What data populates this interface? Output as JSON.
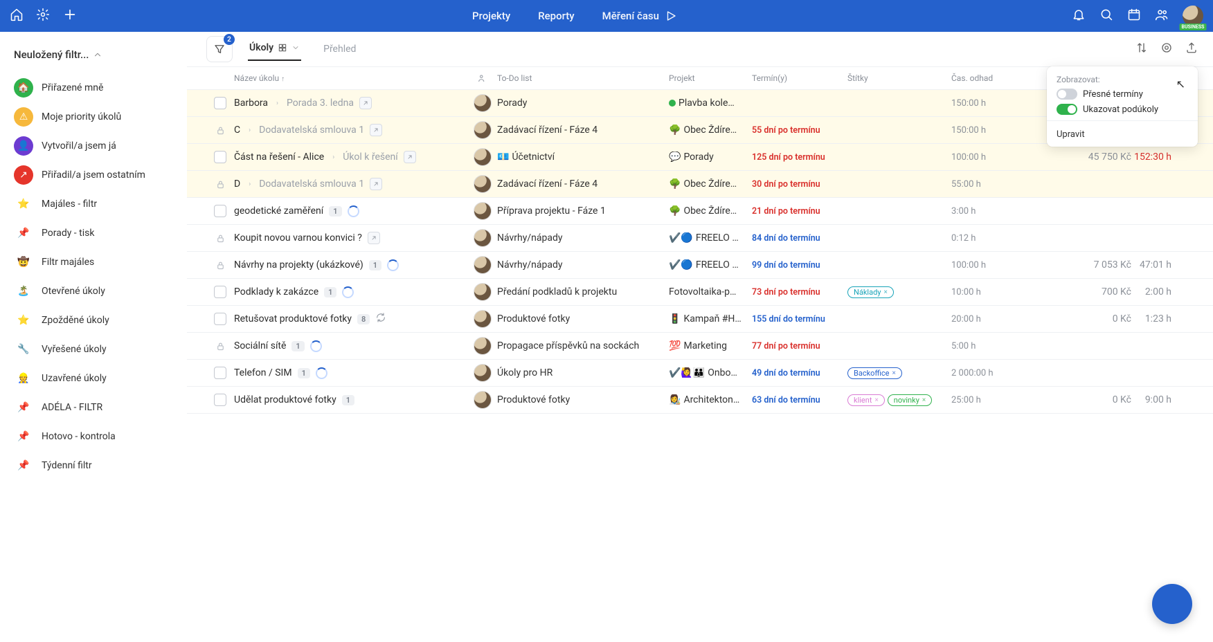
{
  "topbar": {
    "nav": {
      "projects": "Projekty",
      "reports": "Reporty",
      "timetracking": "Měření času"
    }
  },
  "sidebar": {
    "filter_title": "Neuložený filtr...",
    "items": [
      {
        "label": "Přiřazené mně",
        "icon": "🏠",
        "bg": "#2fb24c"
      },
      {
        "label": "Moje priority úkolů",
        "icon": "⚠",
        "bg": "#f6b83c"
      },
      {
        "label": "Vytvořil/a jsem já",
        "icon": "👤",
        "bg": "#6c3bd1"
      },
      {
        "label": "Přiřadil/a jsem ostatním",
        "icon": "↗",
        "bg": "#e5352b"
      },
      {
        "label": "Majáles - filtr",
        "icon": "⭐",
        "bg": "transparent"
      },
      {
        "label": "Porady - tisk",
        "icon": "📌",
        "bg": "transparent"
      },
      {
        "label": "Filtr majáles",
        "icon": "🤠",
        "bg": "transparent"
      },
      {
        "label": "Otevřené úkoly",
        "icon": "🏝️",
        "bg": "transparent"
      },
      {
        "label": "Zpožděné úkoly",
        "icon": "⭐",
        "bg": "transparent"
      },
      {
        "label": "Vyřešené úkoly",
        "icon": "🔧",
        "bg": "transparent"
      },
      {
        "label": "Uzavřené úkoly",
        "icon": "👷",
        "bg": "transparent"
      },
      {
        "label": "ADÉLA - FILTR",
        "icon": "📌",
        "bg": "transparent"
      },
      {
        "label": "Hotovo - kontrola",
        "icon": "📌",
        "bg": "transparent"
      },
      {
        "label": "Týdenní filtr",
        "icon": "📌",
        "bg": "transparent"
      }
    ]
  },
  "tabs": {
    "filter_badge": "2",
    "tasks": "Úkoly",
    "overview": "Přehled"
  },
  "headers": {
    "name": "Název úkolu",
    "todo": "To-Do list",
    "project": "Projekt",
    "terms": "Termín(y)",
    "tags": "Štítky",
    "time": "Čas. odhad"
  },
  "popover": {
    "title": "Zobrazovat:",
    "opt1": "Přesné termíny",
    "opt2": "Ukazovat podúkoly",
    "edit": "Upravit"
  },
  "rows": [
    {
      "hl": true,
      "lock": false,
      "name": "Barbora",
      "sub": "Porada 3. ledna",
      "popout": true,
      "count": "",
      "circle": false,
      "todo": "Porady",
      "projEmoji": "",
      "projDot": "#2fb24c",
      "proj": "Plavba kole…",
      "term": "",
      "termClass": "",
      "tags": [],
      "time": "150:00 h",
      "price": "",
      "dur": "",
      "durRed": false
    },
    {
      "hl": true,
      "lock": true,
      "name": "C",
      "sub": "Dodavatelská smlouva 1",
      "popout": true,
      "count": "",
      "circle": false,
      "todo": "Zadávací řízení - Fáze 4",
      "projEmoji": "🌳",
      "proj": "Obec Ždíre…",
      "term": "55 dní po termínu",
      "termClass": "red",
      "tags": [],
      "time": "150:00 h",
      "price": "",
      "dur": "",
      "durRed": false
    },
    {
      "hl": true,
      "lock": false,
      "name": "Část na řešení - Alice",
      "sub": "Úkol k řešení",
      "popout": true,
      "count": "",
      "circle": false,
      "prefix": "💶",
      "todo": "Účetnictví",
      "projEmoji": "💬",
      "proj": "Porady",
      "term": "125 dní po termínu",
      "termClass": "red",
      "tags": [],
      "time": "100:00 h",
      "price": "45 750 Kč",
      "dur": "152:30 h",
      "durRed": true
    },
    {
      "hl": true,
      "lock": true,
      "name": "D",
      "sub": "Dodavatelská smlouva 1",
      "popout": true,
      "count": "",
      "circle": false,
      "todo": "Zadávací řízení - Fáze 4",
      "projEmoji": "🌳",
      "proj": "Obec Ždíre…",
      "term": "30 dní po termínu",
      "termClass": "red",
      "tags": [],
      "time": "55:00 h",
      "price": "",
      "dur": "",
      "durRed": false
    },
    {
      "hl": false,
      "lock": false,
      "name": "geodetické zaměření",
      "sub": "",
      "popout": false,
      "count": "1",
      "circle": true,
      "todo": "Příprava projektu - Fáze 1",
      "projEmoji": "🌳",
      "proj": "Obec Ždíre…",
      "term": "21 dní po termínu",
      "termClass": "red",
      "tags": [],
      "time": "3:00 h",
      "price": "",
      "dur": "",
      "durRed": false
    },
    {
      "hl": false,
      "lock": true,
      "name": "Koupit novou varnou konvici ?",
      "sub": "",
      "popout": true,
      "count": "",
      "circle": false,
      "todo": "Návrhy/nápady",
      "projEmoji": "✔️🔵",
      "proj": "FREELO …",
      "term": "84 dní do termínu",
      "termClass": "blue",
      "tags": [],
      "time": "0:12 h",
      "price": "",
      "dur": "",
      "durRed": false
    },
    {
      "hl": false,
      "lock": true,
      "name": "Návrhy na projekty (ukázkové)",
      "sub": "",
      "popout": false,
      "count": "1",
      "circle": true,
      "todo": "Návrhy/nápady",
      "projEmoji": "✔️🔵",
      "proj": "FREELO …",
      "term": "99 dní do termínu",
      "termClass": "blue",
      "tags": [],
      "time": "100:00 h",
      "price": "7 053 Kč",
      "dur": "47:01 h",
      "durRed": false
    },
    {
      "hl": false,
      "lock": false,
      "name": "Podklady k zakázce",
      "sub": "",
      "popout": false,
      "count": "1",
      "circle": true,
      "todo": "Předání podkladů k projektu",
      "projEmoji": "",
      "proj": "Fotovoltaika-p…",
      "term": "73 dní po termínu",
      "termClass": "red",
      "tags": [
        {
          "text": "Náklady",
          "color": "#17a3b8"
        }
      ],
      "time": "10:00 h",
      "price": "700 Kč",
      "dur": "2:00 h",
      "durRed": false
    },
    {
      "hl": false,
      "lock": false,
      "name": "Retušovat produktové fotky",
      "sub": "",
      "popout": false,
      "count": "8",
      "circle": false,
      "refresh": true,
      "todo": "Produktové fotky",
      "projEmoji": "🚦",
      "proj": "Kampaň #H…",
      "term": "155 dní do termínu",
      "termClass": "blue",
      "tags": [],
      "time": "20:00 h",
      "price": "0 Kč",
      "dur": "1:23 h",
      "durRed": false
    },
    {
      "hl": false,
      "lock": true,
      "name": "Sociální sítě",
      "sub": "",
      "popout": false,
      "count": "1",
      "circle": true,
      "todo": "Propagace příspěvků na sockách",
      "projEmoji": "💯",
      "proj": "Marketing",
      "term": "77 dní po termínu",
      "termClass": "red",
      "tags": [],
      "time": "5:00 h",
      "price": "",
      "dur": "",
      "durRed": false
    },
    {
      "hl": false,
      "lock": false,
      "name": "Telefon / SIM",
      "sub": "",
      "popout": false,
      "count": "1",
      "circle": true,
      "todo": "Úkoly pro HR",
      "projEmoji": "✔️🙋‍♀️👪",
      "proj": "Onbo…",
      "term": "49 dní do termínu",
      "termClass": "blue",
      "tags": [
        {
          "text": "Backoffice",
          "color": "#2561cc"
        }
      ],
      "time": "2 000:00 h",
      "price": "",
      "dur": "",
      "durRed": false
    },
    {
      "hl": false,
      "lock": false,
      "name": "Udělat produktové fotky",
      "sub": "",
      "popout": false,
      "count": "1",
      "circle": false,
      "todo": "Produktové fotky",
      "projEmoji": "👩‍🎨",
      "proj": "Architekton…",
      "term": "63 dní do termínu",
      "termClass": "blue",
      "tags": [
        {
          "text": "klient",
          "color": "#d97bd4"
        },
        {
          "text": "novinky",
          "color": "#2fb24c"
        }
      ],
      "time": "25:00 h",
      "price": "0 Kč",
      "dur": "9:00 h",
      "durRed": false
    }
  ]
}
